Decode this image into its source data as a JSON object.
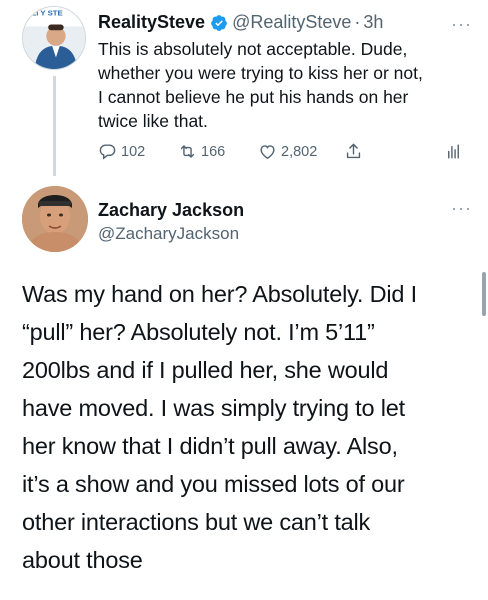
{
  "reply_tweet": {
    "author_name": "RealitySteve",
    "handle": "@RealitySteve",
    "separator": "·",
    "time": "3h",
    "more": "···",
    "avatar_banner": "ALI Y STE",
    "text_lines": [
      "This is absolutely not acceptable. Dude,",
      "whether you were trying to kiss her or not,",
      "I cannot believe he put his hands on her",
      "twice like that."
    ],
    "actions": {
      "replies": "102",
      "retweets": "166",
      "likes": "2,802"
    },
    "icons": {
      "verified": "verified-badge-icon",
      "reply": "reply-icon",
      "retweet": "retweet-icon",
      "like": "heart-icon",
      "share": "share-icon",
      "stats": "stats-icon"
    }
  },
  "main_tweet": {
    "author_name": "Zachary Jackson",
    "handle": "@ZacharyJackson",
    "more": "···",
    "text_lines": [
      "Was my hand on her? Absolutely. Did I",
      "“pull” her? Absolutely not. I’m 5’11”",
      "200lbs and if I pulled her, she would",
      "have moved. I was simply trying to let",
      "her know that I didn’t pull away. Also,",
      "it’s a show and you missed lots of our",
      "other interactions but we can’t talk",
      "about those"
    ]
  },
  "colors": {
    "text_primary": "#0f1419",
    "text_secondary": "#536471",
    "verified_blue": "#1d9bf0",
    "thread_line": "#cfd9de"
  }
}
